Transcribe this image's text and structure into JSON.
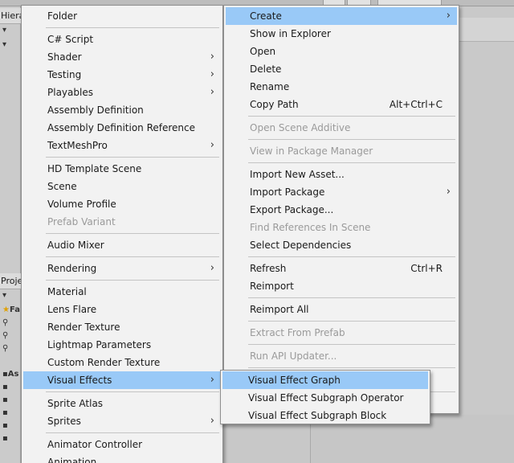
{
  "background": {
    "hierarchy_tab": "Hiera",
    "project_tab": "Proje",
    "favorites_label": "Fa",
    "assets_label": "As"
  },
  "left_menu": {
    "items": [
      {
        "label": "Folder"
      },
      {
        "label": "C# Script"
      },
      {
        "label": "Shader",
        "submenu": true
      },
      {
        "label": "Testing",
        "submenu": true
      },
      {
        "label": "Playables",
        "submenu": true
      },
      {
        "label": "Assembly Definition"
      },
      {
        "label": "Assembly Definition Reference"
      },
      {
        "label": "TextMeshPro",
        "submenu": true
      },
      {
        "label": "HD Template Scene"
      },
      {
        "label": "Scene"
      },
      {
        "label": "Volume Profile"
      },
      {
        "label": "Prefab Variant",
        "disabled": true
      },
      {
        "label": "Audio Mixer"
      },
      {
        "label": "Rendering",
        "submenu": true
      },
      {
        "label": "Material"
      },
      {
        "label": "Lens Flare"
      },
      {
        "label": "Render Texture"
      },
      {
        "label": "Lightmap Parameters"
      },
      {
        "label": "Custom Render Texture"
      },
      {
        "label": "Visual Effects",
        "submenu": true,
        "highlighted": true
      },
      {
        "label": "Sprite Atlas"
      },
      {
        "label": "Sprites",
        "submenu": true
      },
      {
        "label": "Animator Controller"
      },
      {
        "label": "Animation"
      }
    ]
  },
  "main_menu": {
    "items": [
      {
        "label": "Create",
        "submenu": true,
        "highlighted": true
      },
      {
        "label": "Show in Explorer"
      },
      {
        "label": "Open"
      },
      {
        "label": "Delete"
      },
      {
        "label": "Rename"
      },
      {
        "label": "Copy Path",
        "shortcut": "Alt+Ctrl+C"
      },
      {
        "label": "Open Scene Additive",
        "disabled": true
      },
      {
        "label": "View in Package Manager",
        "disabled": true
      },
      {
        "label": "Import New Asset..."
      },
      {
        "label": "Import Package",
        "submenu": true
      },
      {
        "label": "Export Package..."
      },
      {
        "label": "Find References In Scene",
        "disabled": true
      },
      {
        "label": "Select Dependencies"
      },
      {
        "label": "Refresh",
        "shortcut": "Ctrl+R"
      },
      {
        "label": "Reimport"
      },
      {
        "label": "Reimport All"
      },
      {
        "label": "Extract From Prefab",
        "disabled": true
      },
      {
        "label": "Run API Updater...",
        "disabled": true
      }
    ]
  },
  "visual_effects_submenu": {
    "items": [
      {
        "label": "Visual Effect Graph",
        "highlighted": true
      },
      {
        "label": "Visual Effect Subgraph Operator"
      },
      {
        "label": "Visual Effect Subgraph Block"
      }
    ]
  },
  "colors": {
    "highlight": "#99c9f7",
    "menu_bg": "#f2f2f2",
    "disabled_text": "#9a9a9a"
  }
}
